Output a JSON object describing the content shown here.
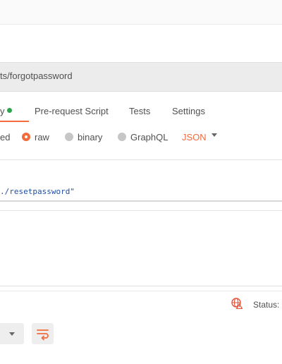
{
  "request": {
    "url_fragment": "ts/forgotpassword"
  },
  "tabs": {
    "body": "y",
    "pre_request": "Pre-request Script",
    "tests": "Tests",
    "settings": "Settings"
  },
  "body_modes": {
    "encoded_tail": "ed",
    "raw": "raw",
    "binary": "binary",
    "graphql": "GraphQL",
    "format": "JSON"
  },
  "editor": {
    "line": "./resetpassword\""
  },
  "response": {
    "status_label": "Status:"
  },
  "colors": {
    "accent": "#f26b3a",
    "active_dot": "#2fa44f",
    "code": "#1f4fa0",
    "globe_icon": "#e5533a"
  }
}
